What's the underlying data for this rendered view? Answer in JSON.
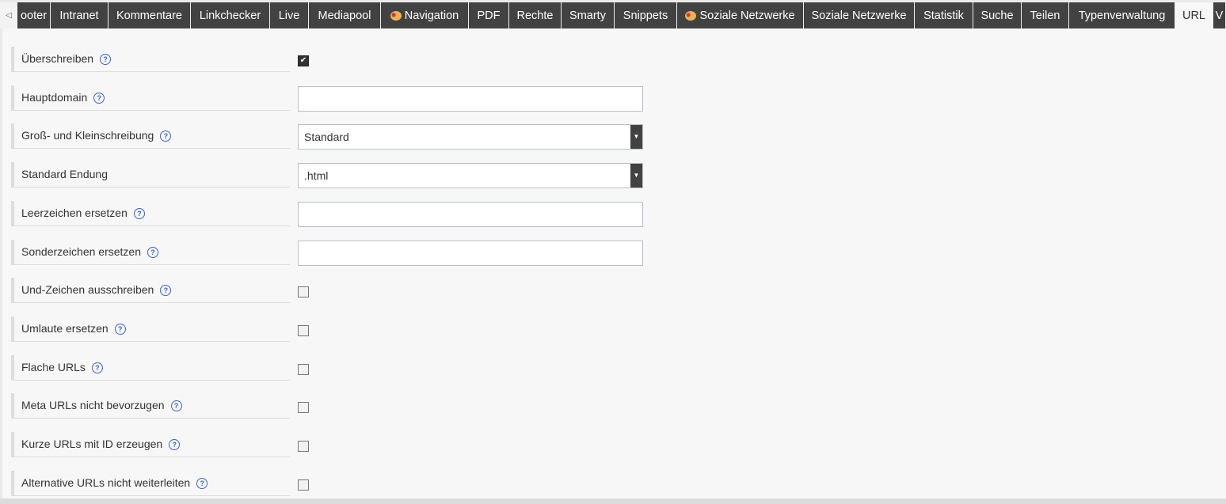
{
  "tabs": [
    {
      "label": "ooter",
      "w": 42
    },
    {
      "label": "Intranet",
      "w": 73
    },
    {
      "label": "Kommentare",
      "w": 104
    },
    {
      "label": "Linkchecker",
      "w": 100
    },
    {
      "label": "Live",
      "w": 49
    },
    {
      "label": "Mediapool",
      "w": 91
    },
    {
      "label": "Navigation",
      "w": 111,
      "icon": true
    },
    {
      "label": "PDF",
      "w": 51
    },
    {
      "label": "Rechte",
      "w": 66
    },
    {
      "label": "Smarty",
      "w": 67
    },
    {
      "label": "Snippets",
      "w": 79
    },
    {
      "label": "Soziale Netzwerke",
      "w": 160,
      "icon": true
    },
    {
      "label": "Soziale Netzwerke",
      "w": 140
    },
    {
      "label": "Statistik",
      "w": 74
    },
    {
      "label": "Suche",
      "w": 61
    },
    {
      "label": "Teilen",
      "w": 60
    },
    {
      "label": "Typenverwaltung",
      "w": 134
    },
    {
      "label": "URL",
      "w": 48,
      "active": true
    },
    {
      "label": "V",
      "w": 16
    }
  ],
  "fields": [
    {
      "label": "Überschreiben",
      "help": true,
      "type": "checkbox",
      "checked": true
    },
    {
      "label": "Hauptdomain",
      "help": true,
      "type": "text",
      "value": ""
    },
    {
      "label": "Groß- und Kleinschreibung",
      "help": true,
      "type": "select",
      "value": "Standard"
    },
    {
      "label": "Standard Endung",
      "help": false,
      "type": "select",
      "value": ".html"
    },
    {
      "label": "Leerzeichen ersetzen",
      "help": true,
      "type": "text",
      "value": ""
    },
    {
      "label": "Sonderzeichen ersetzen",
      "help": true,
      "type": "text",
      "value": ""
    },
    {
      "label": "Und-Zeichen ausschreiben",
      "help": true,
      "type": "checkbox",
      "checked": false
    },
    {
      "label": "Umlaute ersetzen",
      "help": true,
      "type": "checkbox",
      "checked": false
    },
    {
      "label": "Flache URLs",
      "help": true,
      "type": "checkbox",
      "checked": false
    },
    {
      "label": "Meta URLs nicht bevorzugen",
      "help": true,
      "type": "checkbox",
      "checked": false
    },
    {
      "label": "Kurze URLs mit ID erzeugen",
      "help": true,
      "type": "checkbox",
      "checked": false
    },
    {
      "label": "Alternative URLs nicht weiterleiten",
      "help": true,
      "type": "checkbox",
      "checked": false
    }
  ],
  "help_glyph": "?",
  "colors": {
    "tab_bg": "#424242",
    "help": "#3b62c9"
  }
}
